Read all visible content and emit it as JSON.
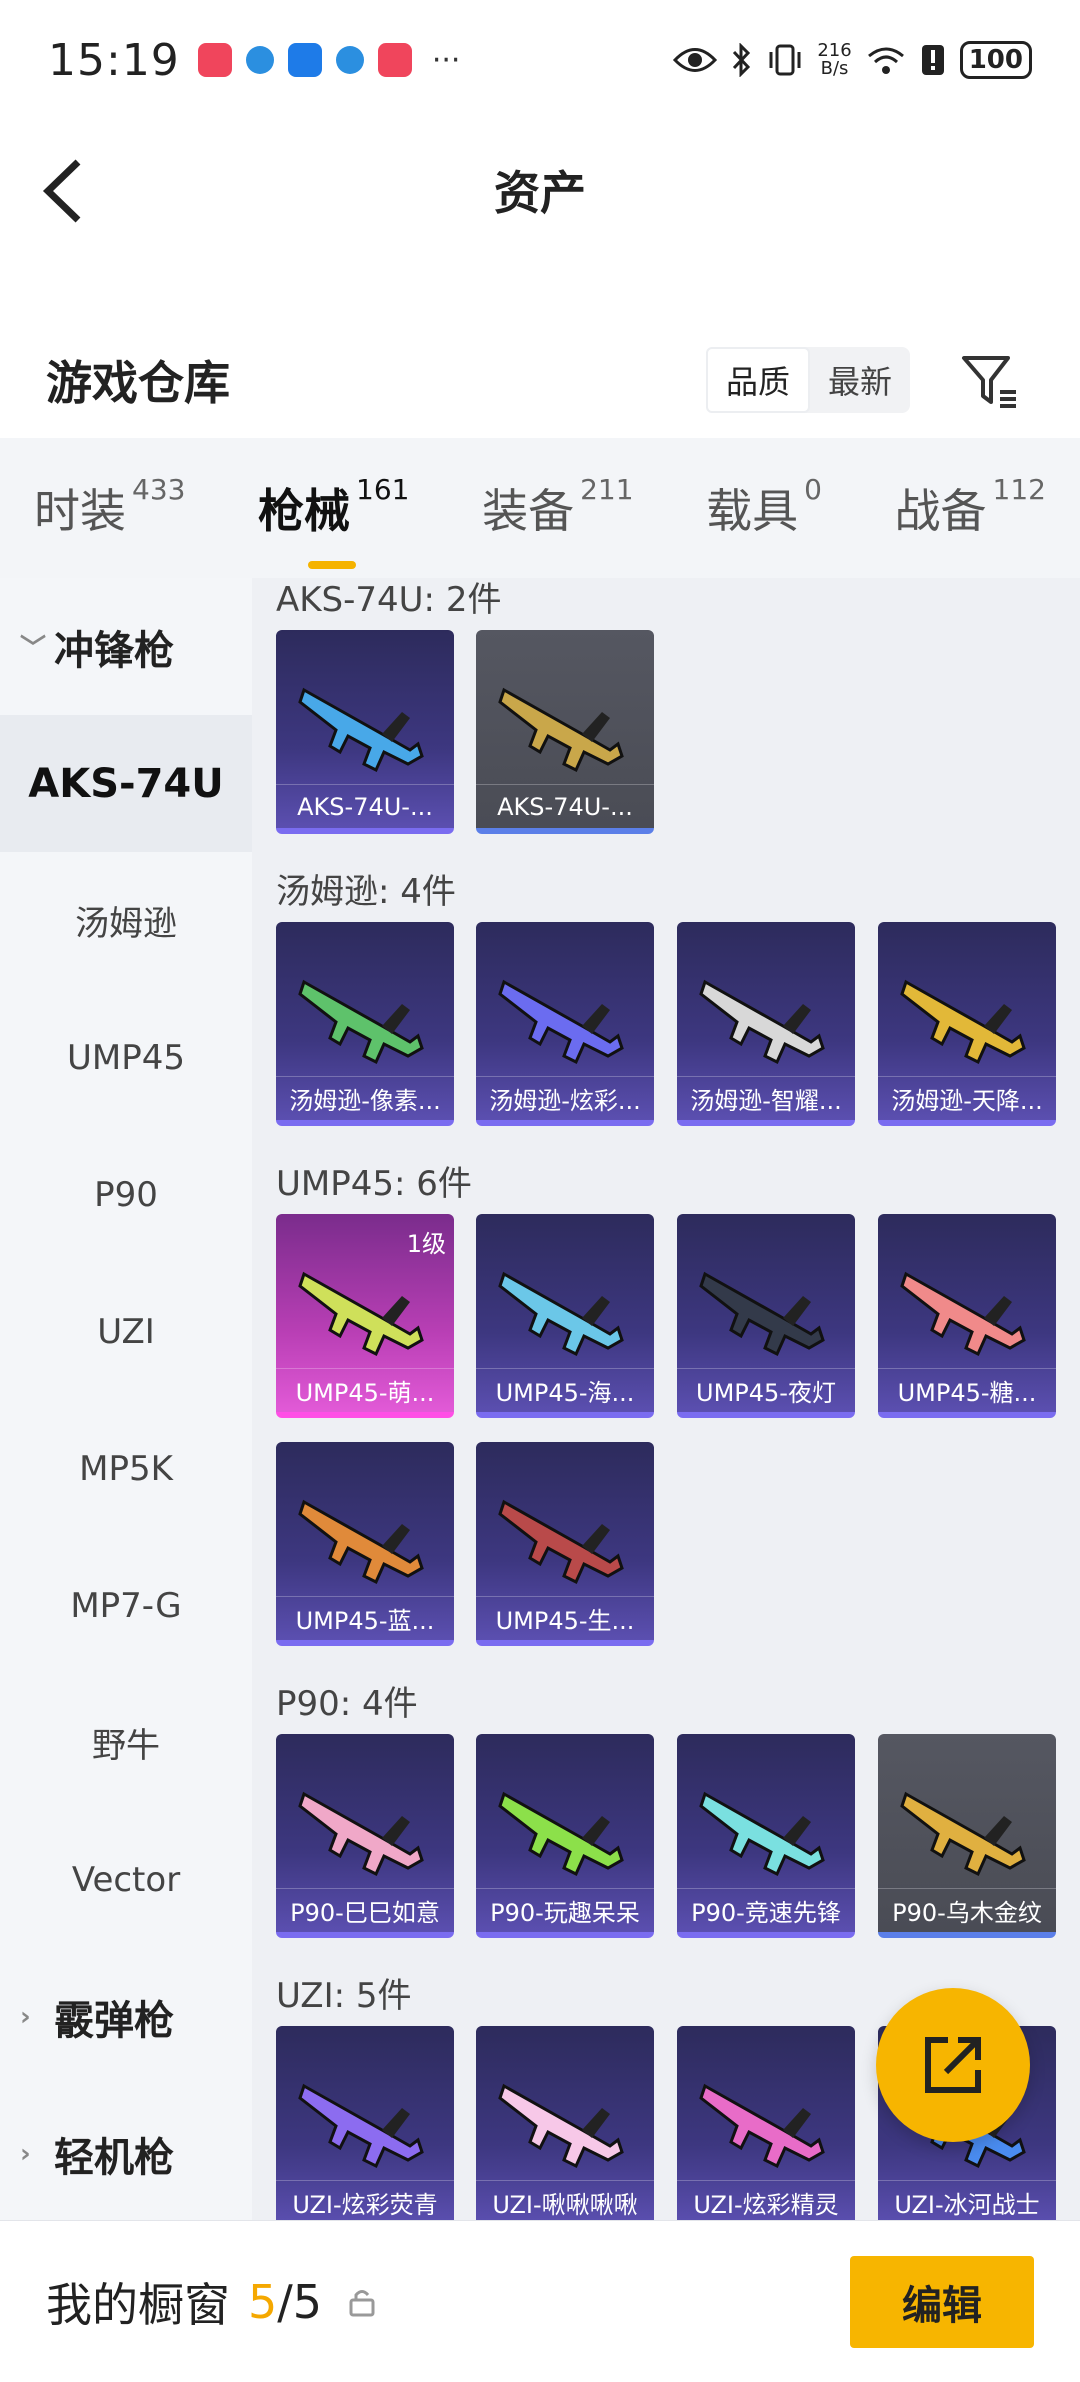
{
  "status_bar": {
    "time": "15:19",
    "more": "···",
    "net_speed_value": "216",
    "net_speed_unit": "B/s",
    "battery": "100"
  },
  "header": {
    "title": "资产"
  },
  "warehouse": {
    "title": "游戏仓库",
    "sort_options": [
      "品质",
      "最新"
    ],
    "sort_selected": "品质"
  },
  "tabs": [
    {
      "label": "时装",
      "count": "433"
    },
    {
      "label": "枪械",
      "count": "161"
    },
    {
      "label": "装备",
      "count": "211"
    },
    {
      "label": "载具",
      "count": "0"
    },
    {
      "label": "战备",
      "count": "112"
    }
  ],
  "active_tab": "枪械",
  "sidebar": {
    "groups": [
      {
        "label": "冲锋枪",
        "expanded": true,
        "items": [
          "AKS-74U",
          "汤姆逊",
          "UMP45",
          "P90",
          "UZI",
          "MP5K",
          "MP7-G",
          "野牛",
          "Vector"
        ]
      },
      {
        "label": "霰弹枪",
        "expanded": false
      },
      {
        "label": "轻机枪",
        "expanded": false
      }
    ],
    "selected": "AKS-74U"
  },
  "sections": [
    {
      "title": "AKS-74U: 2件",
      "items": [
        {
          "name": "AKS-74U-...",
          "style": "purple"
        },
        {
          "name": "AKS-74U-...",
          "style": "grey"
        }
      ]
    },
    {
      "title": "汤姆逊: 4件",
      "items": [
        {
          "name": "汤姆逊-像素...",
          "style": "purple"
        },
        {
          "name": "汤姆逊-炫彩...",
          "style": "purple"
        },
        {
          "name": "汤姆逊-智耀...",
          "style": "purple"
        },
        {
          "name": "汤姆逊-天降...",
          "style": "purple"
        }
      ]
    },
    {
      "title": "UMP45: 6件",
      "items": [
        {
          "name": "UMP45-萌...",
          "style": "pink",
          "level": "1级"
        },
        {
          "name": "UMP45-海...",
          "style": "purple"
        },
        {
          "name": "UMP45-夜灯",
          "style": "purple"
        },
        {
          "name": "UMP45-糖...",
          "style": "purple"
        },
        {
          "name": "UMP45-蓝...",
          "style": "purple"
        },
        {
          "name": "UMP45-生...",
          "style": "purple"
        }
      ]
    },
    {
      "title": "P90: 4件",
      "items": [
        {
          "name": "P90-巳巳如意",
          "style": "purple"
        },
        {
          "name": "P90-玩趣呆呆",
          "style": "purple"
        },
        {
          "name": "P90-竞速先锋",
          "style": "purple"
        },
        {
          "name": "P90-乌木金纹",
          "style": "grey"
        }
      ]
    },
    {
      "title": "UZI: 5件",
      "items": [
        {
          "name": "UZI-炫彩荧青",
          "style": "purple"
        },
        {
          "name": "UZI-啾啾啾啾",
          "style": "purple"
        },
        {
          "name": "UZI-炫彩精灵",
          "style": "purple"
        },
        {
          "name": "UZI-冰河战士",
          "style": "purple"
        }
      ]
    }
  ],
  "bottom_bar": {
    "title": "我的橱窗",
    "used": "5",
    "separator": "/",
    "total": "5",
    "edit_label": "编辑"
  },
  "colors": {
    "accent": "#f7b500",
    "card_purple": "#3d3780",
    "card_pink": "#b93fb5",
    "card_grey": "#4a4c55"
  }
}
